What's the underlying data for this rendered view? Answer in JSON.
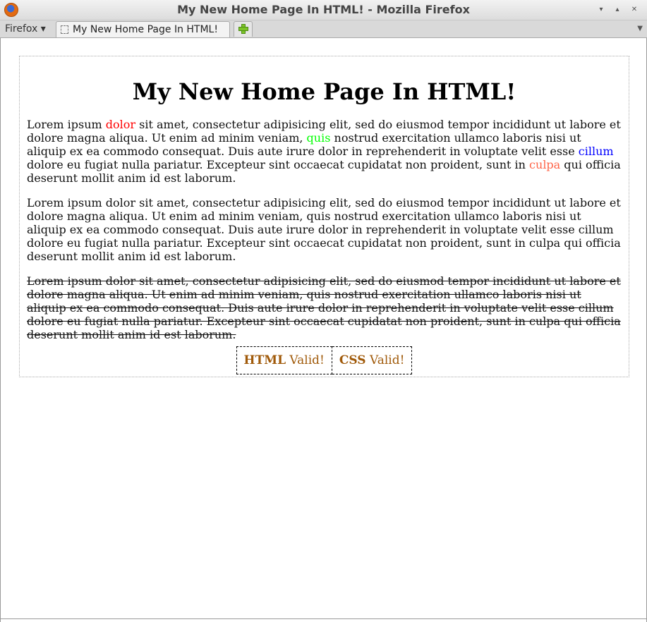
{
  "window": {
    "title": "My New Home Page In HTML! - Mozilla Firefox",
    "controls": [
      "▾",
      "▴",
      "✕"
    ]
  },
  "tabbar": {
    "menu_label": "Firefox ▾",
    "tab_label": "My New Home Page In HTML!",
    "tab_list_icon": "▼"
  },
  "page": {
    "heading": "My New Home Page In HTML!",
    "p1": {
      "s1": "Lorem ipsum ",
      "w1": "dolor",
      "s2": " sit amet, consectetur adipisicing elit, sed do eiusmod tempor incididunt ut labore et dolore magna aliqua. Ut enim ad minim veniam, ",
      "w2": "quis",
      "s3": " nostrud exercitation ullamco laboris nisi ut aliquip ex ea commodo consequat. Duis aute irure dolor in reprehenderit in voluptate velit esse ",
      "w3": "cillum",
      "s4": " dolore eu fugiat nulla pariatur. Excepteur sint occaecat cupidatat non proident, sunt in ",
      "w4": "culpa",
      "s5": " qui officia deserunt mollit anim id est laborum."
    },
    "p2": "Lorem ipsum dolor sit amet, consectetur adipisicing elit, sed do eiusmod tempor incididunt ut labore et dolore magna aliqua. Ut enim ad minim veniam, quis nostrud exercitation ullamco laboris nisi ut aliquip ex ea commodo consequat. Duis aute irure dolor in reprehenderit in voluptate velit esse cillum dolore eu fugiat nulla pariatur. Excepteur sint occaecat cupidatat non proident, sunt in culpa qui officia deserunt mollit anim id est laborum.",
    "p3": "Lorem ipsum dolor sit amet, consectetur adipisicing elit, sed do eiusmod tempor incididunt ut labore et dolore magna aliqua. Ut enim ad minim veniam, quis nostrud exercitation ullamco laboris nisi ut aliquip ex ea commodo consequat. Duis aute irure dolor in reprehenderit in voluptate velit esse cillum dolore eu fugiat nulla pariatur. Excepteur sint occaecat cupidatat non proident, sunt in culpa qui officia deserunt mollit anim id est laborum.",
    "badges": {
      "html_strong": "HTML",
      "html_rest": " Valid!",
      "css_strong": "CSS",
      "css_rest": " Valid!"
    }
  },
  "colors": {
    "word1": "#ff0000",
    "word2": "#00ff00",
    "word3": "#0000ff",
    "word4": "#ff6347",
    "badge_text": "#a05a0a"
  }
}
